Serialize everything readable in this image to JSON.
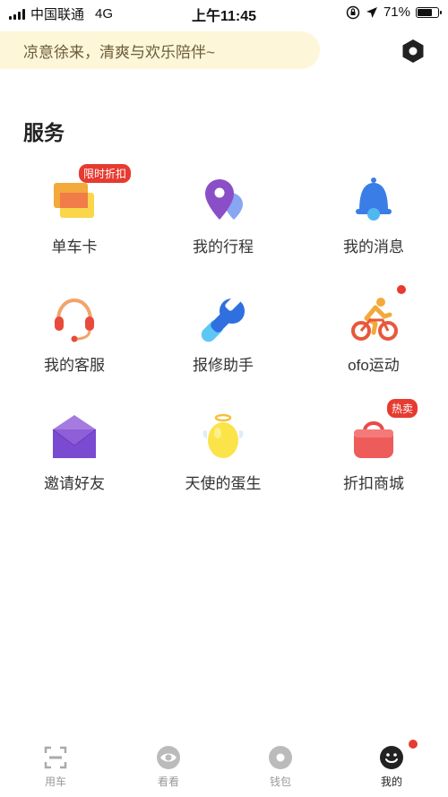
{
  "status_bar": {
    "carrier": "中国联通",
    "network": "4G",
    "time": "上午11:45",
    "battery": "71%",
    "battery_level": 0.71
  },
  "banner": {
    "text": "凉意徐来，清爽与欢乐陪伴~"
  },
  "section": {
    "title": "服务"
  },
  "services": [
    {
      "label": "单车卡",
      "badge": "限时折扣",
      "icon": "bike-card-icon"
    },
    {
      "label": "我的行程",
      "icon": "location-pin-icon"
    },
    {
      "label": "我的消息",
      "icon": "bell-icon"
    },
    {
      "label": "我的客服",
      "icon": "headset-icon"
    },
    {
      "label": "报修助手",
      "icon": "wrench-icon"
    },
    {
      "label": "ofo运动",
      "icon": "cyclist-icon",
      "dot": true
    },
    {
      "label": "邀请好友",
      "icon": "envelope-icon"
    },
    {
      "label": "天使的蛋生",
      "icon": "angel-egg-icon"
    },
    {
      "label": "折扣商城",
      "badge": "热卖",
      "icon": "shopping-bag-icon"
    }
  ],
  "tabbar": {
    "tabs": [
      {
        "label": "用车",
        "icon": "scan-icon"
      },
      {
        "label": "看看",
        "icon": "eye-icon"
      },
      {
        "label": "钱包",
        "icon": "wallet-icon"
      },
      {
        "label": "我的",
        "icon": "smiley-icon"
      }
    ]
  },
  "colors": {
    "banner_bg": "#fdf6d8",
    "badge_red": "#e63b30",
    "tab_inactive": "#999999"
  }
}
